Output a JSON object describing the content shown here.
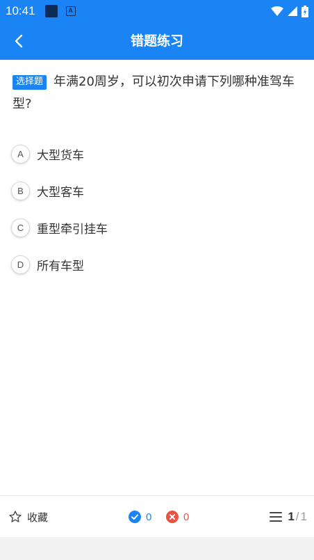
{
  "status_bar": {
    "time": "10:41"
  },
  "app_bar": {
    "title": "错题练习"
  },
  "question": {
    "tag": "选择题",
    "text": "年满20周岁，可以初次申请下列哪种准驾车型?"
  },
  "options": [
    {
      "letter": "A",
      "text": "大型货车"
    },
    {
      "letter": "B",
      "text": "大型客车"
    },
    {
      "letter": "C",
      "text": "重型牵引挂车"
    },
    {
      "letter": "D",
      "text": "所有车型"
    }
  ],
  "bottom_bar": {
    "favorite_label": "收藏",
    "correct_count": "0",
    "wrong_count": "0",
    "current": "1",
    "separator": "/",
    "total": "1"
  },
  "colors": {
    "primary": "#1b84f4",
    "wrong": "#e8543f"
  }
}
